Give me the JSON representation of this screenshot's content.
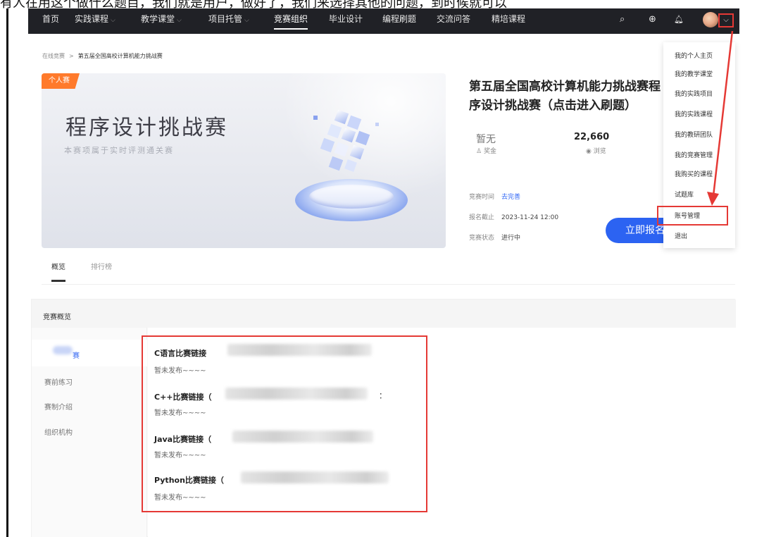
{
  "top_strip": {
    "text": "有人在用这个做什么题目，我们就是用户，做好了，我们来选择其他的问题，到时候就可以"
  },
  "navbar": {
    "items": [
      {
        "label": "首页",
        "has_dropdown": false,
        "active": false
      },
      {
        "label": "实践课程",
        "has_dropdown": true,
        "active": false
      },
      {
        "label": "教学课堂",
        "has_dropdown": true,
        "active": false
      },
      {
        "label": "项目托管",
        "has_dropdown": true,
        "active": false
      },
      {
        "label": "竞赛组织",
        "has_dropdown": false,
        "active": true
      },
      {
        "label": "毕业设计",
        "has_dropdown": false,
        "active": false
      },
      {
        "label": "编程刷题",
        "has_dropdown": false,
        "active": false
      },
      {
        "label": "交流问答",
        "has_dropdown": false,
        "active": false
      },
      {
        "label": "精培课程",
        "has_dropdown": false,
        "active": false
      }
    ],
    "chevron": "⌵",
    "icons": {
      "search": "⌕",
      "add": "⊕",
      "bell": "🔔︎",
      "avatar_dropdown": "⌵"
    }
  },
  "breadcrumb": {
    "root": "在线竞赛",
    "separator": ">",
    "current": "第五届全国高校计算机能力挑战赛"
  },
  "banner": {
    "tag": "个人赛",
    "title": "程序设计挑战赛",
    "subtitle": "本赛项属于实时评测通关赛"
  },
  "competition": {
    "title": "第五届全国高校计算机能力挑战赛程序设计挑战赛（点击进入刷题）",
    "prize": {
      "value": "暂无",
      "label": "奖金"
    },
    "views": {
      "value": "22,660",
      "label": "浏览"
    },
    "info": [
      {
        "key": "竞赛时间",
        "value": "去完善",
        "is_link": true
      },
      {
        "key": "报名截止",
        "value": "2023-11-24 12:00",
        "is_link": false
      },
      {
        "key": "竞赛状态",
        "value": "进行中",
        "is_link": false
      }
    ],
    "signup_label": "立即报名"
  },
  "tabs": [
    {
      "label": "概览",
      "active": true
    },
    {
      "label": "排行榜",
      "active": false
    }
  ],
  "overview": {
    "heading": "竞赛概览",
    "side_items": [
      {
        "label": "赛",
        "active": true
      },
      {
        "label": "赛前练习",
        "active": false
      },
      {
        "label": "赛制介绍",
        "active": false
      },
      {
        "label": "组织机构",
        "active": false
      }
    ],
    "links": [
      {
        "title": "C语言比赛链接",
        "status": "暂未发布~~~~"
      },
      {
        "title": "C++比赛链接（",
        "status": "暂未发布~~~~",
        "suffix": "："
      },
      {
        "title": "Java比赛链接（",
        "status": "暂未发布~~~~"
      },
      {
        "title": "Python比赛链接（",
        "status": "暂未发布~~~~"
      }
    ]
  },
  "user_menu": {
    "items": [
      "我的个人主页",
      "我的教学课堂",
      "我的实践项目",
      "我的实践课程",
      "我的教研团队",
      "我的竞赛管理",
      "我购买的课程",
      "试题库",
      "账号管理",
      "退出"
    ],
    "highlighted_index": 8
  },
  "colors": {
    "navbar_bg": "#202126",
    "accent_blue": "#2c63f2",
    "tag_orange": "#ff7a2b",
    "annotation_red": "#e53935"
  }
}
